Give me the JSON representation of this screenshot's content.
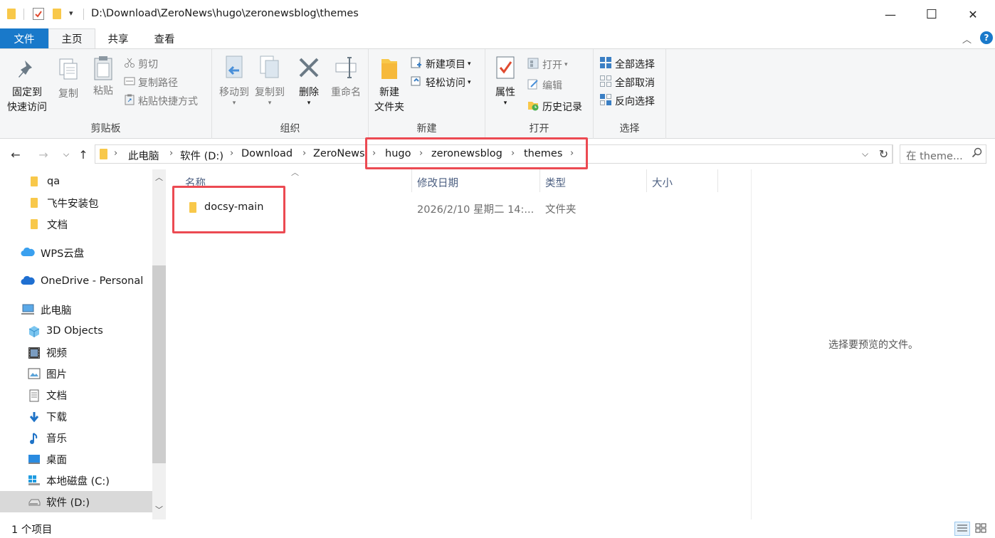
{
  "window": {
    "title": "D:\\Download\\ZeroNews\\hugo\\zeronewsblog\\themes",
    "minimize": "—",
    "maximize": "☐",
    "close": "✕"
  },
  "tabs": [
    {
      "label": "文件"
    },
    {
      "label": "主页"
    },
    {
      "label": "共享"
    },
    {
      "label": "查看"
    }
  ],
  "ribbon": {
    "clipboard": {
      "label": "剪贴板",
      "pin_line1": "固定到",
      "pin_line2": "快速访问",
      "copy": "复制",
      "paste": "粘贴",
      "cut": "剪切",
      "copy_path": "复制路径",
      "paste_shortcut": "粘贴快捷方式"
    },
    "organize": {
      "label": "组织",
      "move_to": "移动到",
      "copy_to": "复制到",
      "delete": "删除",
      "rename": "重命名"
    },
    "new": {
      "label": "新建",
      "new_folder_line1": "新建",
      "new_folder_line2": "文件夹",
      "new_item": "新建项目",
      "easy_access": "轻松访问"
    },
    "open": {
      "label": "打开",
      "properties": "属性",
      "open": "打开",
      "edit": "编辑",
      "history": "历史记录"
    },
    "select": {
      "label": "选择",
      "select_all": "全部选择",
      "select_none": "全部取消",
      "invert": "反向选择"
    }
  },
  "address": {
    "crumbs": [
      "此电脑",
      "软件 (D:)",
      "Download",
      "ZeroNews",
      "hugo",
      "zeronewsblog",
      "themes"
    ],
    "search_placeholder": "在 theme..."
  },
  "sidebar": {
    "items": [
      {
        "label": "qa",
        "icon": "folder-icon"
      },
      {
        "label": "飞牛安装包",
        "icon": "folder-icon"
      },
      {
        "label": "文档",
        "icon": "folder-icon"
      },
      {
        "label": "WPS云盘",
        "icon": "cloud-icon"
      },
      {
        "label": "OneDrive - Personal",
        "icon": "cloud-icon"
      },
      {
        "label": "此电脑",
        "icon": "computer-icon"
      },
      {
        "label": "3D Objects",
        "icon": "cube-icon"
      },
      {
        "label": "视频",
        "icon": "video-icon"
      },
      {
        "label": "图片",
        "icon": "picture-icon"
      },
      {
        "label": "文档",
        "icon": "document-icon"
      },
      {
        "label": "下载",
        "icon": "download-icon"
      },
      {
        "label": "音乐",
        "icon": "music-icon"
      },
      {
        "label": "桌面",
        "icon": "desktop-icon"
      },
      {
        "label": "本地磁盘 (C:)",
        "icon": "windows-drive-icon"
      },
      {
        "label": "软件 (D:)",
        "icon": "drive-icon"
      }
    ]
  },
  "columns": {
    "name": "名称",
    "modified": "修改日期",
    "type": "类型",
    "size": "大小"
  },
  "files": [
    {
      "name": "docsy-main",
      "modified": "2026/2/10 星期二 14:...",
      "type": "文件夹",
      "size": ""
    }
  ],
  "preview": {
    "message": "选择要预览的文件。"
  },
  "status": {
    "count": "1 个项目"
  },
  "colors": {
    "accent": "#1979ca",
    "highlight": "#ec4a52",
    "folder": "#f8c84a"
  }
}
